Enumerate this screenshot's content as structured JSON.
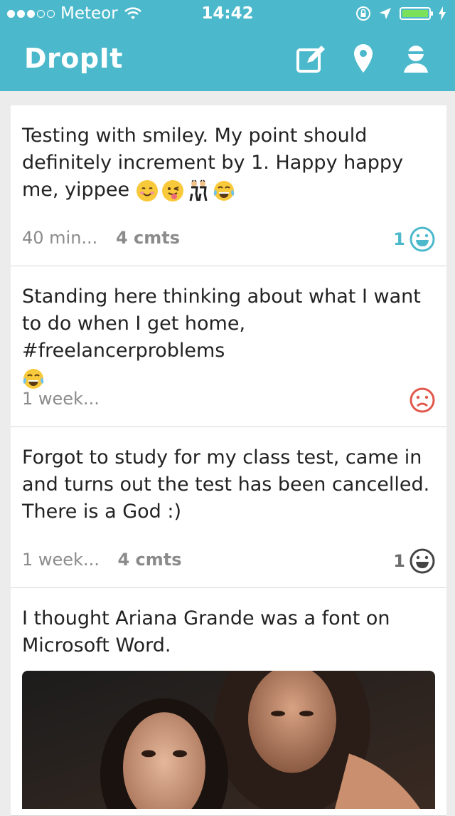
{
  "status_bar": {
    "carrier": "Meteor",
    "time": "14:42"
  },
  "header": {
    "title": "DropIt",
    "icons": [
      "compose-icon",
      "location-pin-icon",
      "profile-icon"
    ]
  },
  "colors": {
    "accent": "#4bb9cb",
    "positive": "#4bb9cb",
    "negative": "#e2574c",
    "neutral": "#6e6e6e"
  },
  "posts": [
    {
      "text": "Testing with smiley. My point should definitely increment by 1. Happy happy me, yippee",
      "emojis": [
        "smiling-face-emoji",
        "winking-tongue-emoji",
        "dancers-emoji",
        "tears-of-joy-emoji"
      ],
      "time": "40 min...",
      "comments": "4 cmts",
      "score": "1",
      "vote_icon": "happy-face-icon",
      "vote_state": "voted"
    },
    {
      "text": "Standing here thinking about what I want to do when I get home, #freelancerproblems",
      "emojis": [
        "tears-of-joy-emoji"
      ],
      "time": "1 week...",
      "comments": "",
      "score": "",
      "vote_icon": "sad-face-icon",
      "vote_state": "negative"
    },
    {
      "text": "Forgot to study for my class test, came in and turns out the test has been cancelled. There is a God :)",
      "emojis": [],
      "time": "1 week...",
      "comments": "4 cmts",
      "score": "1",
      "vote_icon": "happy-face-icon",
      "vote_state": "neutral"
    },
    {
      "text": "I thought Ariana Grande was a font on Microsoft Word.",
      "emojis": [],
      "has_photo": true
    }
  ]
}
